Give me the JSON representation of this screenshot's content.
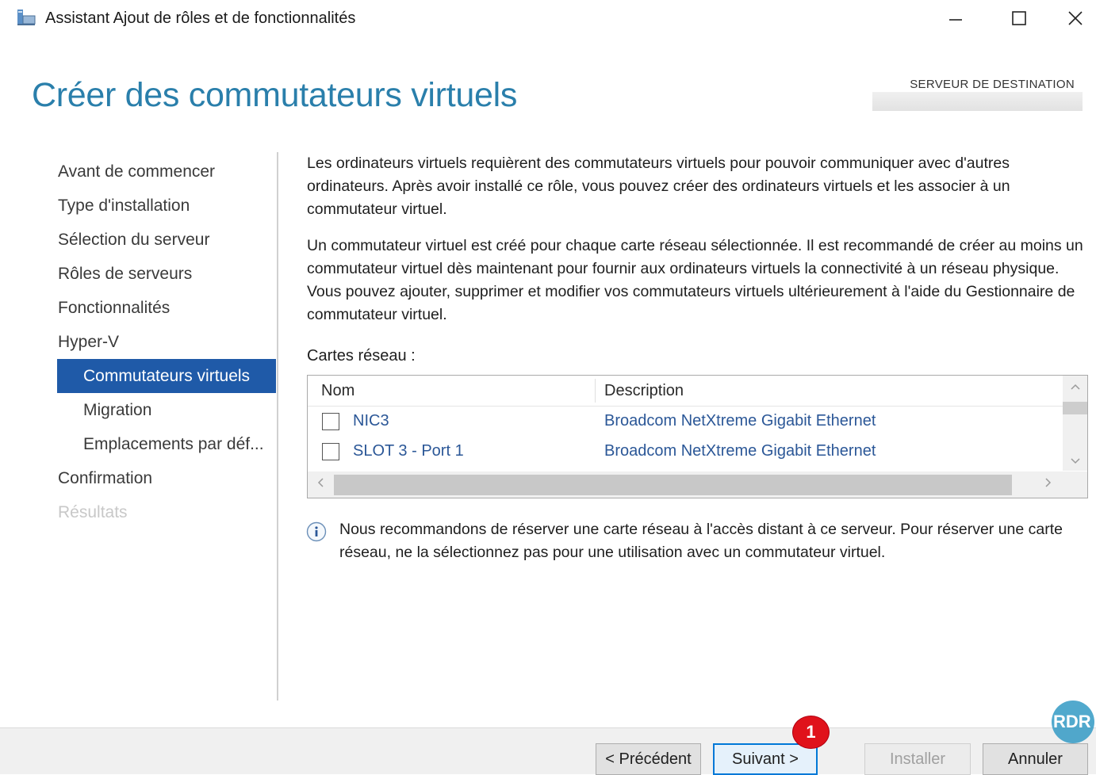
{
  "window": {
    "title": "Assistant Ajout de rôles et de fonctionnalités",
    "controls": {
      "minimize_glyph": "—",
      "maximize_glyph": "☐",
      "close_glyph": "✕"
    }
  },
  "header": {
    "page_title": "Créer des commutateurs virtuels",
    "destination_label": "SERVEUR DE DESTINATION",
    "destination_value": ""
  },
  "nav": {
    "items": [
      {
        "label": "Avant de commencer",
        "state": "normal"
      },
      {
        "label": "Type d'installation",
        "state": "normal"
      },
      {
        "label": "Sélection du serveur",
        "state": "normal"
      },
      {
        "label": "Rôles de serveurs",
        "state": "normal"
      },
      {
        "label": "Fonctionnalités",
        "state": "normal"
      },
      {
        "label": "Hyper-V",
        "state": "normal"
      },
      {
        "label": "Commutateurs virtuels",
        "state": "active"
      },
      {
        "label": "Migration",
        "state": "sub"
      },
      {
        "label": "Emplacements par déf...",
        "state": "sub"
      },
      {
        "label": "Confirmation",
        "state": "normal"
      },
      {
        "label": "Résultats",
        "state": "disabled"
      }
    ]
  },
  "content": {
    "paragraph1": "Les ordinateurs virtuels requièrent des commutateurs virtuels pour pouvoir communiquer avec d'autres ordinateurs. Après avoir installé ce rôle, vous pouvez créer des ordinateurs virtuels et les associer à un commutateur virtuel.",
    "paragraph2": "Un commutateur virtuel est créé pour chaque carte réseau sélectionnée. Il est recommandé de créer au moins un commutateur virtuel dès maintenant pour fournir aux ordinateurs virtuels la connectivité à un réseau physique. Vous pouvez ajouter, supprimer et modifier vos commutateurs virtuels ultérieurement à l'aide du Gestionnaire de commutateur virtuel.",
    "cards_label": "Cartes réseau :",
    "table": {
      "columns": [
        "Nom",
        "Description"
      ],
      "rows": [
        {
          "name": "NIC3",
          "description": "Broadcom NetXtreme Gigabit Ethernet",
          "checked": false
        },
        {
          "name": "SLOT 3 - Port 1",
          "description": "Broadcom NetXtreme Gigabit Ethernet",
          "checked": false
        }
      ]
    },
    "info_text": "Nous recommandons de réserver une carte réseau à l'accès distant à ce serveur. Pour réserver une carte réseau, ne la sélectionnez pas pour une utilisation avec un commutateur virtuel."
  },
  "footer": {
    "prev_label": "< Précédent",
    "next_label": "Suivant >",
    "install_label": "Installer",
    "cancel_label": "Annuler"
  },
  "annotation": {
    "badge_number": "1",
    "watermark_text": "RDR"
  },
  "colors": {
    "title_blue": "#2a7fab",
    "nav_active": "#1f5aa8",
    "link_blue": "#2b5797",
    "badge_red": "#e0121b"
  }
}
